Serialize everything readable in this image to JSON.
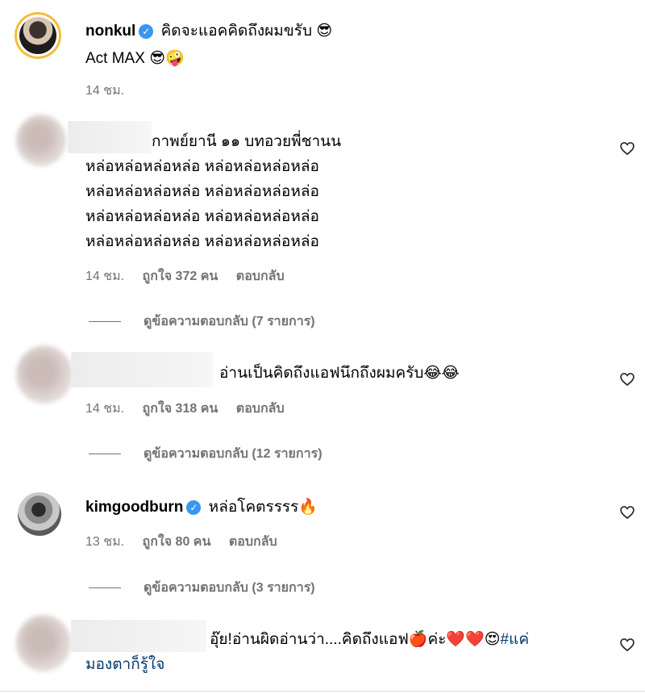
{
  "post": {
    "username": "nonkul",
    "verified_mark": "✓",
    "caption_line1": "คิดจะแอคคิดถึงผมขรับ",
    "caption_line1_emoji": "😎",
    "caption_line2": "Act MAX",
    "caption_line2_emoji": "😎🤪",
    "time": "14 ชม."
  },
  "comments": [
    {
      "lines": [
        "กาพย์ยานี ๑๑ บทอวยพี่ชานน",
        "หล่อหล่อหล่อหล่อ หล่อหล่อหล่อหล่อ",
        "หล่อหล่อหล่อหล่อ หล่อหล่อหล่อหล่อ",
        "หล่อหล่อหล่อหล่อ หล่อหล่อหล่อหล่อ",
        "หล่อหล่อหล่อหล่อ หล่อหล่อหล่อหล่อ"
      ],
      "time": "14 ชม.",
      "likes": "ถูกใจ 372 คน",
      "reply": "ตอบกลับ",
      "view_replies": "ดูข้อความตอบกลับ (7 รายการ)"
    },
    {
      "text": "อ่านเป็นคิดถึงแอฟนึกถึงผมครับ",
      "emoji": "😂😂",
      "time": "14 ชม.",
      "likes": "ถูกใจ 318 คน",
      "reply": "ตอบกลับ",
      "view_replies": "ดูข้อความตอบกลับ (12 รายการ)"
    },
    {
      "username": "kimgoodburn",
      "verified_mark": "✓",
      "text": "หล่อโคตรรรร",
      "emoji": "🔥",
      "time": "13 ชม.",
      "likes": "ถูกใจ 80 คน",
      "reply": "ตอบกลับ",
      "view_replies": "ดูข้อความตอบกลับ (3 รายการ)"
    },
    {
      "text_part1": "อุ๊ย!อ่านผิดอ่านว่า....คิดถึงแอฟ",
      "emoji1": "🍎",
      "text_part2": "ค่ะ",
      "emoji2": "❤️❤️😍",
      "hashtag": "#แค่มองตาก็รู้ใจ",
      "hashtag_line1": "#แค่",
      "hashtag_line2": "มองตาก็รู้ใจ"
    }
  ],
  "icons": {
    "like": "heart-outline-icon",
    "verified": "verified-badge-icon"
  },
  "colors": {
    "verified": "#3897f0",
    "meta_text": "#737373",
    "hashtag": "#00376b",
    "story_ring": "#f4bd3b"
  }
}
